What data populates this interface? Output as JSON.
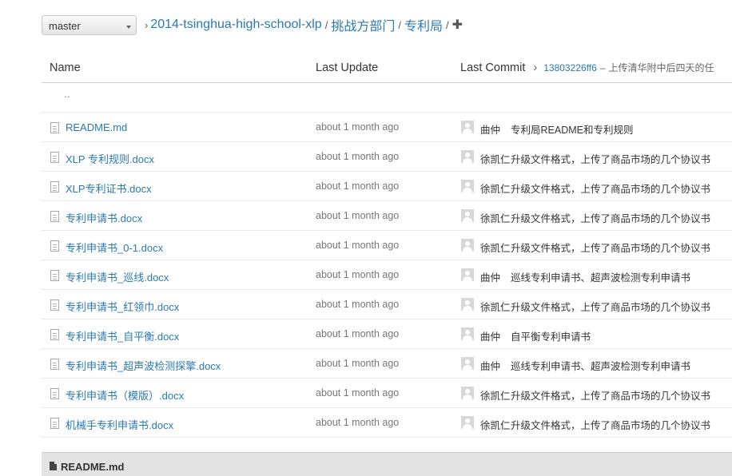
{
  "branch": {
    "selected": "master"
  },
  "breadcrumb": {
    "separator": "›",
    "repo": "2014-tsinghua-high-school-xlp",
    "folder1": "挑战方部门",
    "folder2": "专利局",
    "slash": "/",
    "add_icon": "plus-icon"
  },
  "table": {
    "headers": {
      "name": "Name",
      "last_update": "Last Update",
      "last_commit": "Last Commit"
    },
    "latest_commit": {
      "chevron": "›",
      "sha": "13803226ff6",
      "dash": "–",
      "message": "上传清华附中后四天的任"
    },
    "parent_dir": "..",
    "rows": [
      {
        "name": "README.md",
        "updated": "about 1 month ago",
        "author": "曲仲",
        "message": "专利局README和专利规则"
      },
      {
        "name": "XLP 专利规则.docx",
        "updated": "about 1 month ago",
        "author": "徐凯仁",
        "message": "升级文件格式，上传了商品市场的几个协议书"
      },
      {
        "name": "XLP专利证书.docx",
        "updated": "about 1 month ago",
        "author": "徐凯仁",
        "message": "升级文件格式，上传了商品市场的几个协议书"
      },
      {
        "name": "专利申请书.docx",
        "updated": "about 1 month ago",
        "author": "徐凯仁",
        "message": "升级文件格式，上传了商品市场的几个协议书"
      },
      {
        "name": "专利申请书_0-1.docx",
        "updated": "about 1 month ago",
        "author": "徐凯仁",
        "message": "升级文件格式，上传了商品市场的几个协议书"
      },
      {
        "name": "专利申请书_巡线.docx",
        "updated": "about 1 month ago",
        "author": "曲仲",
        "message": "巡线专利申请书、超声波检测专利申请书"
      },
      {
        "name": "专利申请书_红领巾.docx",
        "updated": "about 1 month ago",
        "author": "徐凯仁",
        "message": "升级文件格式，上传了商品市场的几个协议书"
      },
      {
        "name": "专利申请书_自平衡.docx",
        "updated": "about 1 month ago",
        "author": "曲仲",
        "message": "自平衡专利申请书"
      },
      {
        "name": "专利申请书_超声波检测探擎.docx",
        "updated": "about 1 month ago",
        "author": "曲仲",
        "message": "巡线专利申请书、超声波检测专利申请书"
      },
      {
        "name": "专利申请书（模版）.docx",
        "updated": "about 1 month ago",
        "author": "徐凯仁",
        "message": "升级文件格式，上传了商品市场的几个协议书"
      },
      {
        "name": "机械手专利申请书.docx",
        "updated": "about 1 month ago",
        "author": "徐凯仁",
        "message": "升级文件格式，上传了商品市场的几个协议书"
      }
    ]
  },
  "readme": {
    "title": "README.md"
  },
  "colors": {
    "link": "#2a7ab0",
    "muted": "#777777",
    "header_bar": "#e3e3e3"
  }
}
